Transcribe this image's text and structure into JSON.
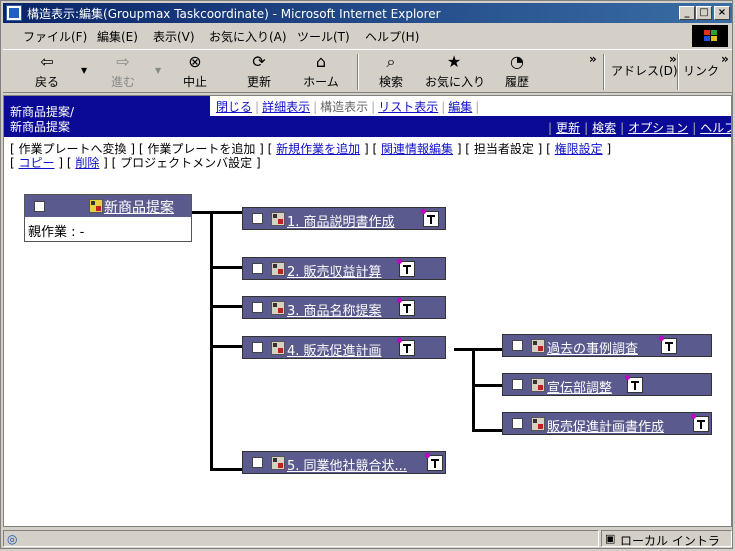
{
  "window": {
    "title": "構造表示:編集(Groupmax Taskcoordinate) - Microsoft Internet Explorer"
  },
  "menu": [
    "ファイル(F)",
    "編集(E)",
    "表示(V)",
    "お気に入り(A)",
    "ツール(T)",
    "ヘルプ(H)"
  ],
  "toolbar": {
    "back": "戻る",
    "forward": "進む",
    "stop": "中止",
    "refresh": "更新",
    "home": "ホーム",
    "search": "検索",
    "favorites": "お気に入り",
    "history": "履歴",
    "chevron": "»",
    "address": "アドレス(D)",
    "links": "リンク"
  },
  "header": {
    "project_line1": "新商品提案/",
    "project_line2": "新商品提案",
    "tabs": [
      "閉じる",
      "詳細表示",
      "構造表示",
      "リスト表示",
      "編集"
    ],
    "right_links": [
      "更新",
      "検索",
      "オプション",
      "ヘルプ"
    ]
  },
  "actions": {
    "convert_template": "作業プレートへ変換",
    "add_template": "作業プレートを追加",
    "add_new_task": "新規作業を追加",
    "edit_related": "関連情報編集",
    "assignee": "担当者設定",
    "permissions": "権限設定",
    "copy": "コピー",
    "delete": "削除",
    "project_members": "プロジェクトメンバ設定"
  },
  "tree": {
    "root": {
      "title": "新商品提案",
      "parent_label": "親作業 : -"
    },
    "children": [
      "1. 商品説明書作成",
      "2. 販売収益計算",
      "3. 商品名称提案",
      "4. 販売促進計画",
      "5. 同業他社競合状..."
    ],
    "sub_children": [
      "過去の事例調査",
      "宣伝部調整",
      "販売促進計画書作成"
    ]
  },
  "status": {
    "zone": "ローカル イントラ"
  }
}
